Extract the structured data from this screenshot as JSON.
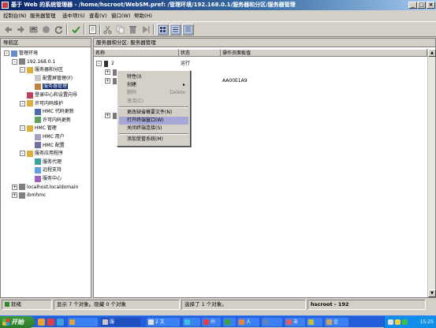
{
  "window": {
    "title": "基于 Web 的系统管理器 - /home/hscroot/WebSM.pref: /管理环境/192.168.0.1/服务器和分区/服务器管理",
    "minimize": "_",
    "maximize": "□",
    "close": "×"
  },
  "menubar": [
    "控制台(N)",
    "服务器管理",
    "选中项(S)",
    "查看(V)",
    "窗口(W)",
    "帮助(H)"
  ],
  "toolbar": {
    "icons": [
      "back-icon",
      "forward-icon",
      "up-icon",
      "stop-icon",
      "refresh-icon",
      "check-icon",
      "properties-icon",
      "cut-icon",
      "copy-icon",
      "delete-icon",
      "run-icon",
      "large-icons-view",
      "small-icons-view",
      "details-view"
    ]
  },
  "nav": {
    "header": "导航区",
    "items": [
      {
        "label": "管理环境",
        "expander": "-",
        "level": 0
      },
      {
        "label": "192.168.0.1",
        "expander": "-",
        "level": 1
      },
      {
        "label": "服务器和分区",
        "expander": "-",
        "level": 2
      },
      {
        "label": "配置屏管理(F)",
        "expander": "",
        "level": 3
      },
      {
        "label": "服务器管理",
        "expander": "",
        "level": 3,
        "selected": true
      },
      {
        "label": "登录中心和设置向导",
        "expander": "",
        "level": 2
      },
      {
        "label": "许可内码维护",
        "expander": "-",
        "level": 2
      },
      {
        "label": "HMC 代码更新",
        "expander": "",
        "level": 3
      },
      {
        "label": "许可内码更新",
        "expander": "",
        "level": 3
      },
      {
        "label": "HMC 管理",
        "expander": "-",
        "level": 2
      },
      {
        "label": "HMC 用户",
        "expander": "",
        "level": 3
      },
      {
        "label": "HMC 配置",
        "expander": "",
        "level": 3
      },
      {
        "label": "服务应用程序",
        "expander": "-",
        "level": 2
      },
      {
        "label": "服务代理",
        "expander": "",
        "level": 3
      },
      {
        "label": "远程支持",
        "expander": "",
        "level": 3
      },
      {
        "label": "服务中心",
        "expander": "",
        "level": 3
      },
      {
        "label": "localhost.localdomain",
        "expander": "+",
        "level": 1
      },
      {
        "label": "ibmhmc",
        "expander": "+",
        "level": 1
      }
    ]
  },
  "content": {
    "header": "服务器和分区: 服务器管理",
    "columns": [
      "名称",
      "状态",
      "操作员面板值"
    ],
    "rows": [
      {
        "expander": "-",
        "name": "2",
        "status": "运行",
        "panel": ""
      },
      {
        "expander": "+",
        "name": "",
        "status": "",
        "panel": ""
      },
      {
        "expander": "+",
        "name": "",
        "status": "件",
        "panel": "AA00E1A9"
      },
      {
        "expander": "+",
        "name": "",
        "status": "",
        "panel": ""
      }
    ]
  },
  "context_menu": {
    "items": [
      {
        "label": "特性(I)",
        "disabled": false
      },
      {
        "label": "创建",
        "disabled": false,
        "submenu": true
      },
      {
        "label": "删除",
        "disabled": true,
        "accel": "Delete"
      },
      {
        "label": "激活(C)",
        "disabled": true
      },
      {
        "label": "更改缺省概要文件(N)",
        "disabled": false
      },
      {
        "label": "打开终端窗口(W)",
        "disabled": false,
        "highlighted": true
      },
      {
        "label": "关闭终端连接(S)",
        "disabled": false
      },
      {
        "label": "添加受管系统(M)",
        "disabled": false
      }
    ],
    "arrow": "▸"
  },
  "statusbar": {
    "ready": "就绪",
    "objects": "显示 7 个对象。隐藏 0 个对象",
    "selected": "选择了 1 个对象。",
    "user": "hscroot - 192"
  },
  "taskbar": {
    "start": "开始",
    "tasks": [
      "",
      "服",
      "2 文",
      "",
      "Ⓜ",
      "",
      "人",
      "",
      "未",
      "",
      "企"
    ],
    "clock": "15:25"
  },
  "colors": {
    "title_start": "#0a246a",
    "selection": "#0a246a",
    "menu_highlight": "#a8a8d8",
    "taskbar": "#245edb",
    "start": "#3c9a3c"
  }
}
